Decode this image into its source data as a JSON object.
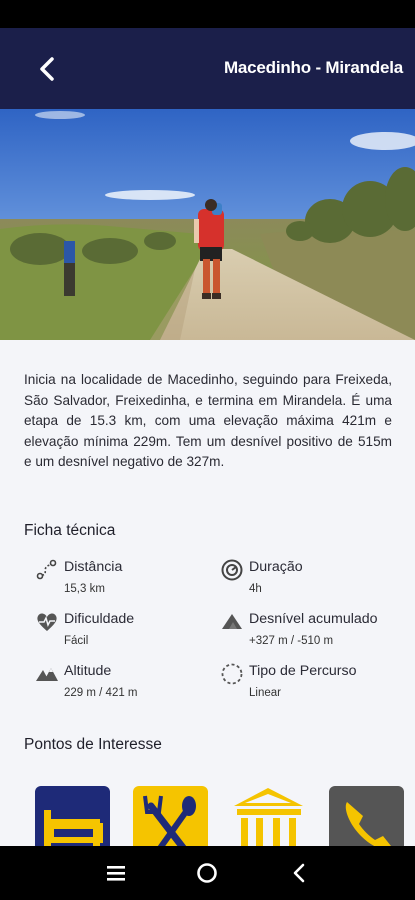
{
  "header": {
    "title": "Macedinho - Mirandela",
    "back_icon": "arrow-left-icon"
  },
  "hero_image": {
    "alt": "hiker-on-trail-photo"
  },
  "description": "Inicia na localidade de Macedinho, seguindo para Freixeda, São Salvador, Freixedinha, e termina em Mirandela. É uma etapa de 15.3 km, com uma elevação máxima 421m e elevação mínima 229m. Tem um desnível positivo de 515m e um desnível negativo de 327m.",
  "tech_sheet": {
    "title": "Ficha técnica",
    "distance": {
      "label": "Distância",
      "value": "15,3 km",
      "icon": "route-icon"
    },
    "duration": {
      "label": "Duração",
      "value": "4h",
      "icon": "timer-icon"
    },
    "difficulty": {
      "label": "Dificuldade",
      "value": "Fácil",
      "icon": "heart-pulse-icon"
    },
    "elevation_gain": {
      "label": "Desnível acumulado",
      "value": "+327 m / -510 m",
      "icon": "mountain-icon"
    },
    "altitude": {
      "label": "Altitude",
      "value": "229 m / 421 m",
      "icon": "mountains-icon"
    },
    "route_type": {
      "label": "Tipo de Percurso",
      "value": "Linear",
      "icon": "dashed-circle-icon"
    }
  },
  "points_of_interest": {
    "title": "Pontos de Interesse",
    "items": [
      {
        "name": "accommodation",
        "icon": "bed-icon",
        "bg": "#1e2a78",
        "fg": "#f5c400"
      },
      {
        "name": "restaurant",
        "icon": "cutlery-icon",
        "bg": "#f5c400",
        "fg": "#1e2a78"
      },
      {
        "name": "monument",
        "icon": "museum-icon",
        "bg": "#f4f5f9",
        "fg": "#f5c400"
      },
      {
        "name": "contacts",
        "icon": "phone-icon",
        "bg": "#555555",
        "fg": "#f5c400"
      }
    ]
  },
  "colors": {
    "header_bg": "#1b1f4a",
    "accent_yellow": "#f5c400",
    "accent_navy": "#1e2a78"
  },
  "nav": {
    "recent_icon": "recent-apps-icon",
    "home_icon": "home-circle-icon",
    "back_icon": "back-chevron-icon"
  }
}
